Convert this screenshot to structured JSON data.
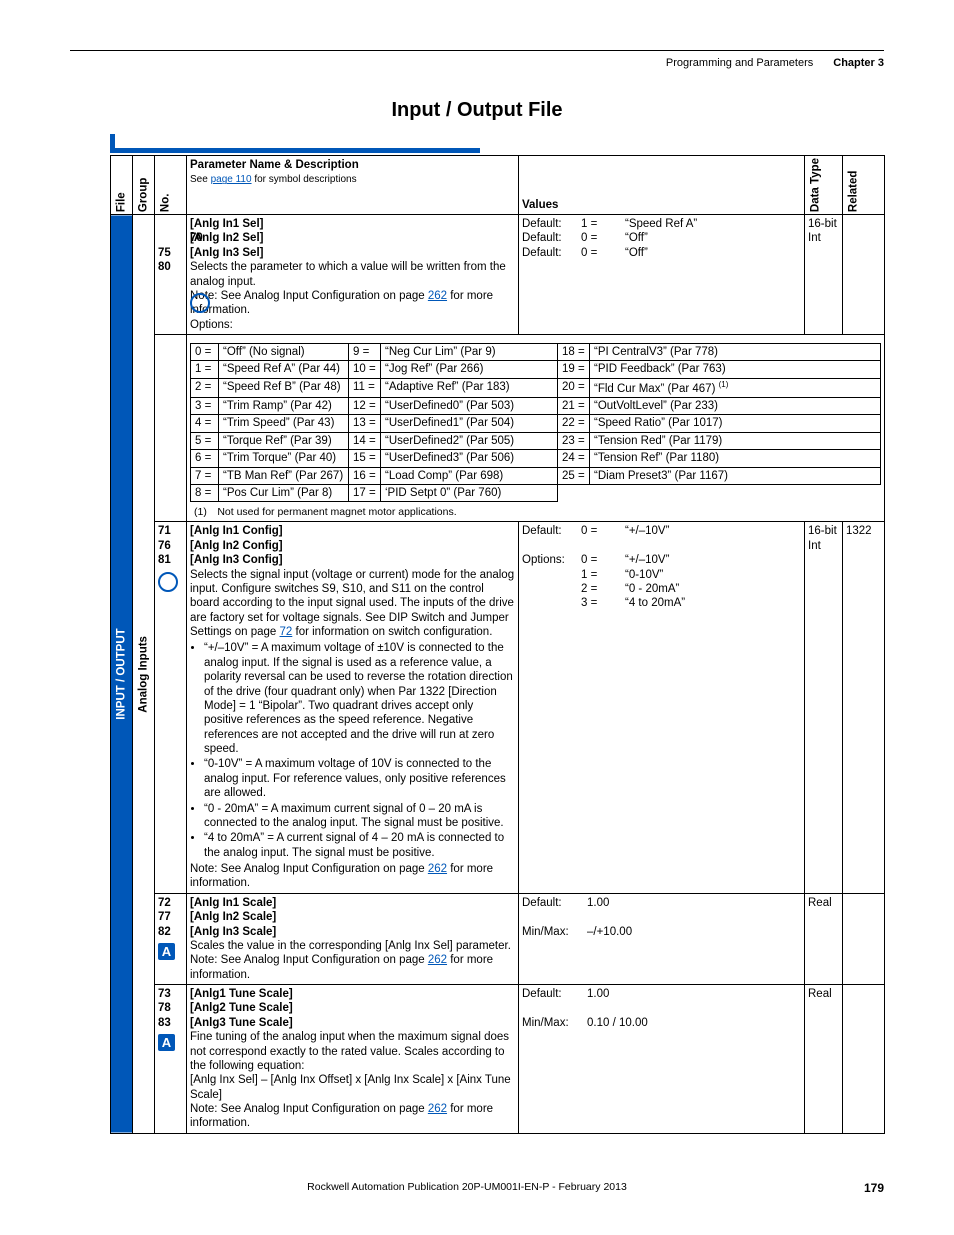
{
  "header": {
    "section": "Programming and Parameters",
    "chapter": "Chapter 3"
  },
  "title": "Input / Output File",
  "colheads": {
    "file": "File",
    "group": "Group",
    "no": "No.",
    "param": "Parameter Name & Description",
    "param_sub_pre": "See ",
    "param_sub_link": "page 110",
    "param_sub_post": " for symbol descriptions",
    "values": "Values",
    "dtype": "Data Type",
    "related": "Related"
  },
  "file_label": "INPUT / OUTPUT",
  "group_label": "Analog Inputs",
  "row1": {
    "nos": "70\n75\n80",
    "names": "[Anlg In1 Sel]\n[Anlg In2 Sel]\n[Anlg In3 Sel]",
    "desc1": "Selects the parameter to which a value will be written from the analog input.",
    "desc2a": "Note: See Analog Input Configuration on page ",
    "desc2b": "262",
    "desc2c": " for more information.",
    "desc3": "Options:",
    "defaults": "Default:\nDefault:\nDefault:",
    "def_codes": "1 =\n0 =\n0 =",
    "def_vals": "“Speed Ref A”\n“Off”\n“Off”",
    "dtype": "16-bit\nInt",
    "related": "",
    "footnote": "(1) Not used for permanent magnet motor applications."
  },
  "options": [
    [
      "0 =",
      "“Off” (No signal)",
      "9 =",
      "“Neg Cur Lim” (Par 9)",
      "18 =",
      "“PI CentralV3” (Par 778)"
    ],
    [
      "1 =",
      "“Speed Ref A” (Par 44)",
      "10 =",
      "“Jog Ref” (Par 266)",
      "19 =",
      "“PID Feedback” (Par 763)"
    ],
    [
      "2 =",
      "“Speed Ref B” (Par 48)",
      "11 =",
      "“Adaptive Ref” (Par 183)",
      "20 =",
      "“Fld Cur Max” (Par 467) <sup>(1)</sup>"
    ],
    [
      "3 =",
      "“Trim Ramp” (Par 42)",
      "12 =",
      "“UserDefined0” (Par 503)",
      "21 =",
      "“OutVoltLevel” (Par 233)"
    ],
    [
      "4 =",
      "“Trim Speed” (Par 43)",
      "13 =",
      "“UserDefined1” (Par 504)",
      "22 =",
      "“Speed Ratio” (Par 1017)"
    ],
    [
      "5 =",
      "“Torque Ref” (Par 39)",
      "14 =",
      "“UserDefined2” (Par 505)",
      "23 =",
      "“Tension Red” (Par 1179)"
    ],
    [
      "6 =",
      "“Trim Torque” (Par 40)",
      "15 =",
      "“UserDefined3” (Par 506)",
      "24 =",
      "“Tension Ref” (Par 1180)"
    ],
    [
      "7 =",
      "“TB Man Ref” (Par 267)",
      "16 =",
      "“Load Comp” (Par 698)",
      "25 =",
      "“Diam Preset3” (Par 1167)"
    ],
    [
      "8 =",
      "“Pos Cur Lim” (Par 8)",
      "17 =",
      "‘PID Setpt 0” (Par 760)",
      "",
      ""
    ]
  ],
  "row2": {
    "nos": "71\n76\n81",
    "names": "[Anlg In1 Config]\n[Anlg In2 Config]\n[Anlg In3 Config]",
    "desc_main": "Selects the signal input (voltage or current) mode for the analog input. Configure switches S9, S10, and S11 on the control board according to the input signal used. The inputs of the drive are factory set for voltage signals. See DIP Switch and Jumper Settings on page ",
    "desc_main_link": "72",
    "desc_main2": " for information on switch configuration.",
    "b1": "“+/–10V” = A maximum voltage of ±10V is connected to the analog input. If the signal is used as a reference value, a polarity reversal can be used to reverse the rotation direction of the drive (four quadrant only) when Par 1322 [Direction Mode] = 1 “Bipolar”. Two quadrant drives accept only positive references as the speed reference. Negative references are not accepted and the drive will run at zero speed.",
    "b2": "“0-10V” = A maximum voltage of 10V is connected to the analog input. For reference values, only positive references are allowed.",
    "b3": "“0 - 20mA” = A maximum current signal of 0 – 20 mA is connected to the analog input. The signal must be positive.",
    "b4": "“4 to 20mA” = A current signal of 4 – 20 mA is connected to the analog input. The signal must be positive.",
    "note_a": "Note: See Analog Input Configuration on page ",
    "note_b": "262",
    "note_c": " for more information.",
    "val_left": "Default:\n\nOptions:",
    "val_codes": "0 =\n\n0 =\n1 =\n2 =\n3 =",
    "val_vals": "“+/–10V”\n\n“+/–10V”\n“0-10V”\n“0 - 20mA”\n“4 to 20mA”",
    "dtype": "16-bit\nInt",
    "related": "1322"
  },
  "row3": {
    "nos": "72\n77\n82",
    "names": "[Anlg In1 Scale]\n[Anlg In2 Scale]\n[Anlg In3 Scale]",
    "desc": "Scales the value in the corresponding [Anlg Inx Sel] parameter.",
    "note_a": "Note: See Analog Input Configuration on page ",
    "note_b": "262",
    "note_c": " for more information.",
    "val_left": "Default:\n\nMin/Max:",
    "val_right": "1.00\n\n–/+10.00",
    "dtype": "Real",
    "related": ""
  },
  "row4": {
    "nos": "73\n78\n83",
    "names": "[Anlg1 Tune Scale]\n[Anlg2 Tune Scale]\n[Anlg3 Tune Scale]",
    "desc1": "Fine tuning of the analog input when the maximum signal does not correspond exactly to the rated value. Scales according to the following equation:",
    "desc2": "[Anlg Inx Sel] – [Anlg Inx Offset] x [Anlg Inx Scale] x [Ainx Tune Scale]",
    "note_a": "Note: See Analog Input Configuration on page ",
    "note_b": "262",
    "note_c": " for more information.",
    "val_left": "Default:\n\nMin/Max:",
    "val_right": "1.00\n\n0.10 / 10.00",
    "dtype": "Real",
    "related": ""
  },
  "footer": {
    "pub": "Rockwell Automation Publication 20P-UM001I-EN-P - February 2013",
    "page": "179"
  }
}
